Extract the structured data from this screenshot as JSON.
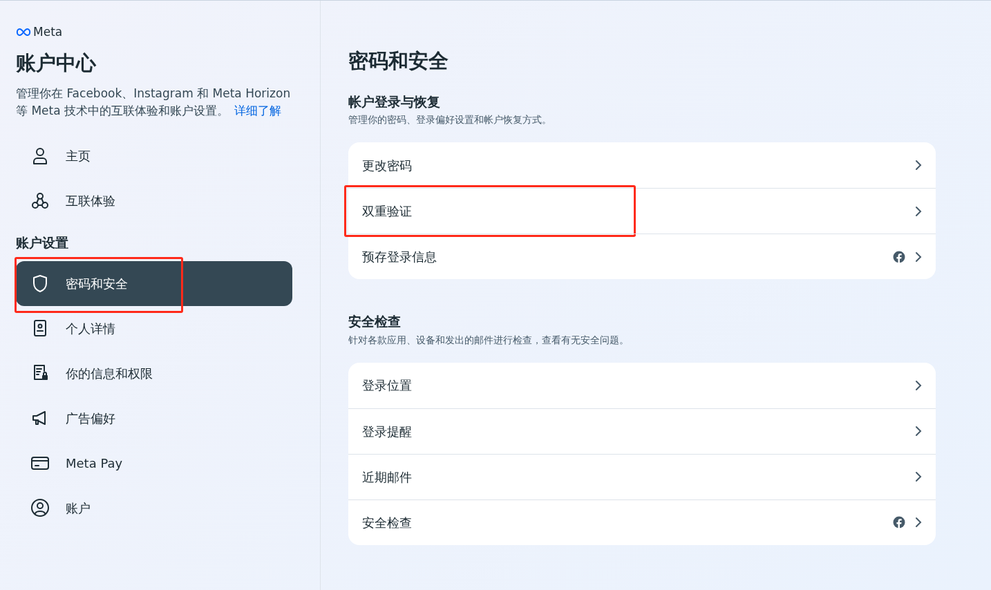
{
  "sidebar": {
    "brand": "Meta",
    "title": "账户中心",
    "description": "管理你在 Facebook、Instagram 和 Meta Horizon 等 Meta 技术中的互联体验和账户设置。",
    "learn_more": "详细了解",
    "top_items": [
      {
        "label": "主页",
        "selected": false,
        "annotated": false
      },
      {
        "label": "互联体验",
        "selected": false,
        "annotated": false
      }
    ],
    "section_title": "账户设置",
    "settings_items": [
      {
        "label": "密码和安全",
        "selected": true,
        "annotated": true
      },
      {
        "label": "个人详情",
        "selected": false,
        "annotated": false
      },
      {
        "label": "你的信息和权限",
        "selected": false,
        "annotated": false
      },
      {
        "label": "广告偏好",
        "selected": false,
        "annotated": false
      },
      {
        "label": "Meta Pay",
        "selected": false,
        "annotated": false
      },
      {
        "label": "账户",
        "selected": false,
        "annotated": false
      }
    ]
  },
  "main": {
    "title": "密码和安全",
    "sections": [
      {
        "title": "帐户登录与恢复",
        "subtitle": "管理你的密码、登录偏好设置和帐户恢复方式。",
        "rows": [
          {
            "label": "更改密码",
            "facebook_badge": false,
            "annotated": false
          },
          {
            "label": "双重验证",
            "facebook_badge": false,
            "annotated": true
          },
          {
            "label": "预存登录信息",
            "facebook_badge": true,
            "annotated": false
          }
        ]
      },
      {
        "title": "安全检查",
        "subtitle": "针对各款应用、设备和发出的邮件进行检查，查看有无安全问题。",
        "rows": [
          {
            "label": "登录位置",
            "facebook_badge": false,
            "annotated": false
          },
          {
            "label": "登录提醒",
            "facebook_badge": false,
            "annotated": false
          },
          {
            "label": "近期邮件",
            "facebook_badge": false,
            "annotated": false
          },
          {
            "label": "安全检查",
            "facebook_badge": true,
            "annotated": false
          }
        ]
      }
    ]
  }
}
